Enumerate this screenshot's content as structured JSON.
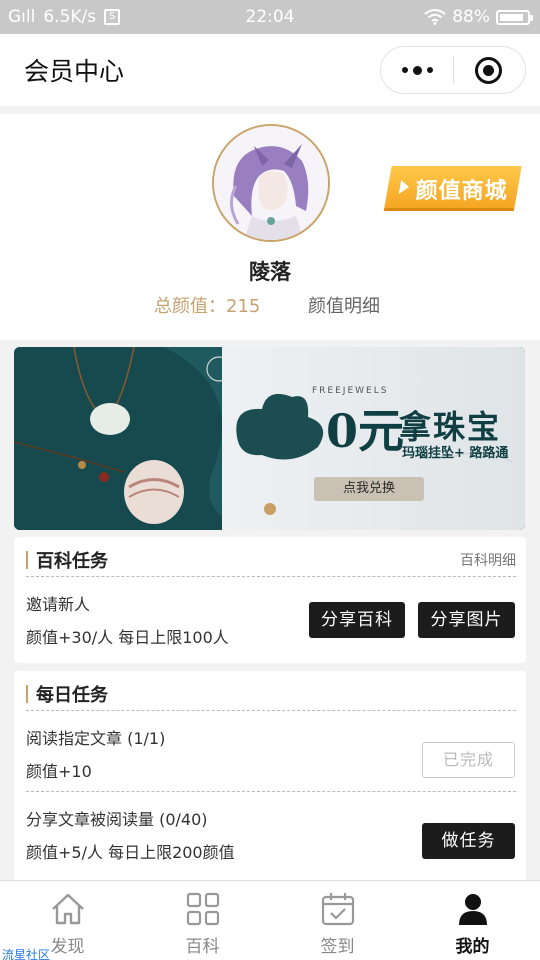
{
  "status_bar": {
    "carrier": "Gıll",
    "speed": "6.5K/s",
    "time": "22:04",
    "battery": "88%",
    "battery_level": 0.88
  },
  "title_bar": {
    "title": "会员中心",
    "menu_icon": "more-dots-icon",
    "close_icon": "target-close-icon"
  },
  "profile": {
    "username": "陵落",
    "score_label": "总颜值：215",
    "score_detail": "颜值明细",
    "shop_badge": "颜值商城"
  },
  "banner": {
    "tag": "FREEJEWELS",
    "zero": "0元",
    "headline": "拿珠宝",
    "subline": "玛瑙挂坠+ 路路通",
    "cta": "点我兑换"
  },
  "encyclopedia_tasks": {
    "title": "百科任务",
    "link": "百科明细",
    "tasks": [
      {
        "name": "邀请新人",
        "reward": "颜值+30/人 每日上限100人",
        "buttons": [
          "分享百科",
          "分享图片"
        ]
      }
    ]
  },
  "daily_tasks": {
    "title": "每日任务",
    "tasks": [
      {
        "name": "阅读指定文章 (1/1)",
        "reward": "颜值+10",
        "button": "已完成",
        "done": true
      },
      {
        "name": "分享文章被阅读量 (0/40)",
        "reward": "颜值+5/人 每日上限200颜值",
        "button": "做任务",
        "done": false
      }
    ]
  },
  "tab_bar": {
    "tabs": [
      {
        "label": "发现",
        "icon": "home-icon",
        "active": false
      },
      {
        "label": "百科",
        "icon": "grid-icon",
        "active": false
      },
      {
        "label": "签到",
        "icon": "calendar-check-icon",
        "active": false
      },
      {
        "label": "我的",
        "icon": "user-icon",
        "active": true
      }
    ]
  },
  "watermark": "流星社区",
  "colors": {
    "accent_gold": "#c9a46a",
    "badge_orange": "#f5a623",
    "button_dark": "#1c1c1c"
  }
}
